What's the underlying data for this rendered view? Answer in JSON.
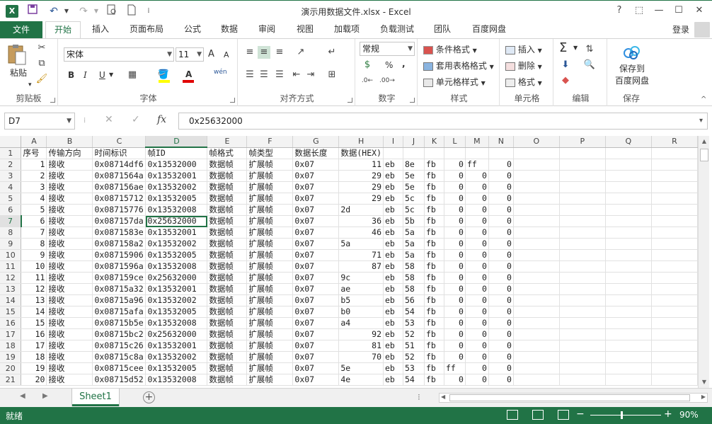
{
  "window": {
    "title": "演示用数据文件.xlsx - Excel",
    "help": "?",
    "restore_ribbon": "⬚",
    "minimize": "—",
    "maximize": "☐",
    "close": "✕"
  },
  "quick_access": {
    "undo": "↶",
    "redo": "↷",
    "separator": "⁞"
  },
  "tabs": {
    "file": "文件",
    "items": [
      "开始",
      "插入",
      "页面布局",
      "公式",
      "数据",
      "审阅",
      "视图",
      "加载项",
      "负载测试",
      "团队",
      "百度网盘"
    ],
    "active_index": 0,
    "login": "登录"
  },
  "ribbon": {
    "clipboard": {
      "paste": "粘贴",
      "label": "剪贴板"
    },
    "font": {
      "name": "宋体",
      "size": "11",
      "bold": "B",
      "italic": "I",
      "underline": "U",
      "grow": "A",
      "shrink": "A",
      "phonetic": "wén",
      "label": "字体"
    },
    "alignment": {
      "label": "对齐方式"
    },
    "number": {
      "format": "常规",
      "percent": "%",
      "comma": ",",
      "label": "数字"
    },
    "styles": {
      "conditional": "条件格式",
      "table": "套用表格格式",
      "cell": "单元格样式",
      "label": "样式"
    },
    "cells": {
      "insert": "插入",
      "delete": "删除",
      "format": "格式",
      "label": "单元格"
    },
    "editing": {
      "sum": "Σ",
      "label": "编辑"
    },
    "save": {
      "line1": "保存到",
      "line2": "百度网盘",
      "label": "保存"
    }
  },
  "formula_bar": {
    "name_box": "D7",
    "cancel": "✕",
    "enter": "✓",
    "fx": "fx",
    "value": "0x25632000"
  },
  "grid": {
    "columns": [
      "A",
      "B",
      "C",
      "D",
      "E",
      "F",
      "G",
      "H",
      "I",
      "J",
      "K",
      "L",
      "M",
      "N",
      "O",
      "P",
      "Q",
      "R"
    ],
    "selected_column": "D",
    "selected_row": 7,
    "header_row": [
      "序号",
      "传输方向",
      "时间标识",
      "帧ID",
      "帧格式",
      "帧类型",
      "数据长度",
      "数据(HEX)",
      "",
      "",
      "",
      "",
      "",
      "",
      "",
      "",
      "",
      ""
    ],
    "rows": [
      [
        "1",
        "接收",
        "0x08714df6",
        "0x13532000",
        "数据帧",
        "扩展帧",
        "0x07",
        "11",
        "eb",
        "8e",
        "fb",
        "0",
        "ff",
        "0",
        "",
        "",
        "",
        ""
      ],
      [
        "2",
        "接收",
        "0x0871564a",
        "0x13532001",
        "数据帧",
        "扩展帧",
        "0x07",
        "29",
        "eb",
        "5e",
        "fb",
        "0",
        "0",
        "0",
        "",
        "",
        "",
        ""
      ],
      [
        "3",
        "接收",
        "0x087156ae",
        "0x13532002",
        "数据帧",
        "扩展帧",
        "0x07",
        "29",
        "eb",
        "5e",
        "fb",
        "0",
        "0",
        "0",
        "",
        "",
        "",
        ""
      ],
      [
        "4",
        "接收",
        "0x08715712",
        "0x13532005",
        "数据帧",
        "扩展帧",
        "0x07",
        "29",
        "eb",
        "5c",
        "fb",
        "0",
        "0",
        "0",
        "",
        "",
        "",
        ""
      ],
      [
        "5",
        "接收",
        "0x08715776",
        "0x13532008",
        "数据帧",
        "扩展帧",
        "0x07",
        "2d",
        "eb",
        "5c",
        "fb",
        "0",
        "0",
        "0",
        "",
        "",
        "",
        ""
      ],
      [
        "6",
        "接收",
        "0x087157da",
        "0x25632000",
        "数据帧",
        "扩展帧",
        "0x07",
        "36",
        "eb",
        "5b",
        "fb",
        "0",
        "0",
        "0",
        "",
        "",
        "",
        ""
      ],
      [
        "7",
        "接收",
        "0x0871583e",
        "0x13532001",
        "数据帧",
        "扩展帧",
        "0x07",
        "46",
        "eb",
        "5a",
        "fb",
        "0",
        "0",
        "0",
        "",
        "",
        "",
        ""
      ],
      [
        "8",
        "接收",
        "0x087158a2",
        "0x13532002",
        "数据帧",
        "扩展帧",
        "0x07",
        "5a",
        "eb",
        "5a",
        "fb",
        "0",
        "0",
        "0",
        "",
        "",
        "",
        ""
      ],
      [
        "9",
        "接收",
        "0x08715906",
        "0x13532005",
        "数据帧",
        "扩展帧",
        "0x07",
        "71",
        "eb",
        "5a",
        "fb",
        "0",
        "0",
        "0",
        "",
        "",
        "",
        ""
      ],
      [
        "10",
        "接收",
        "0x0871596a",
        "0x13532008",
        "数据帧",
        "扩展帧",
        "0x07",
        "87",
        "eb",
        "58",
        "fb",
        "0",
        "0",
        "0",
        "",
        "",
        "",
        ""
      ],
      [
        "11",
        "接收",
        "0x087159ce",
        "0x25632000",
        "数据帧",
        "扩展帧",
        "0x07",
        "9c",
        "eb",
        "58",
        "fb",
        "0",
        "0",
        "0",
        "",
        "",
        "",
        ""
      ],
      [
        "12",
        "接收",
        "0x08715a32",
        "0x13532001",
        "数据帧",
        "扩展帧",
        "0x07",
        "ae",
        "eb",
        "58",
        "fb",
        "0",
        "0",
        "0",
        "",
        "",
        "",
        ""
      ],
      [
        "13",
        "接收",
        "0x08715a96",
        "0x13532002",
        "数据帧",
        "扩展帧",
        "0x07",
        "b5",
        "eb",
        "56",
        "fb",
        "0",
        "0",
        "0",
        "",
        "",
        "",
        ""
      ],
      [
        "14",
        "接收",
        "0x08715afa",
        "0x13532005",
        "数据帧",
        "扩展帧",
        "0x07",
        "b0",
        "eb",
        "54",
        "fb",
        "0",
        "0",
        "0",
        "",
        "",
        "",
        ""
      ],
      [
        "15",
        "接收",
        "0x08715b5e",
        "0x13532008",
        "数据帧",
        "扩展帧",
        "0x07",
        "a4",
        "eb",
        "53",
        "fb",
        "0",
        "0",
        "0",
        "",
        "",
        "",
        ""
      ],
      [
        "16",
        "接收",
        "0x08715bc2",
        "0x25632000",
        "数据帧",
        "扩展帧",
        "0x07",
        "92",
        "eb",
        "52",
        "fb",
        "0",
        "0",
        "0",
        "",
        "",
        "",
        ""
      ],
      [
        "17",
        "接收",
        "0x08715c26",
        "0x13532001",
        "数据帧",
        "扩展帧",
        "0x07",
        "81",
        "eb",
        "51",
        "fb",
        "0",
        "0",
        "0",
        "",
        "",
        "",
        ""
      ],
      [
        "18",
        "接收",
        "0x08715c8a",
        "0x13532002",
        "数据帧",
        "扩展帧",
        "0x07",
        "70",
        "eb",
        "52",
        "fb",
        "0",
        "0",
        "0",
        "",
        "",
        "",
        ""
      ],
      [
        "19",
        "接收",
        "0x08715cee",
        "0x13532005",
        "数据帧",
        "扩展帧",
        "0x07",
        "5e",
        "eb",
        "53",
        "fb",
        "ff",
        "0",
        "0",
        "",
        "",
        "",
        ""
      ],
      [
        "20",
        "接收",
        "0x08715d52",
        "0x13532008",
        "数据帧",
        "扩展帧",
        "0x07",
        "4e",
        "eb",
        "54",
        "fb",
        "0",
        "0",
        "0",
        "",
        "",
        "",
        ""
      ]
    ]
  },
  "sheets": {
    "active": "Sheet1",
    "add": "+"
  },
  "status": {
    "ready": "就绪",
    "zoom": "90%",
    "zoom_out": "−",
    "zoom_in": "+"
  },
  "colors": {
    "accent": "#217346"
  }
}
